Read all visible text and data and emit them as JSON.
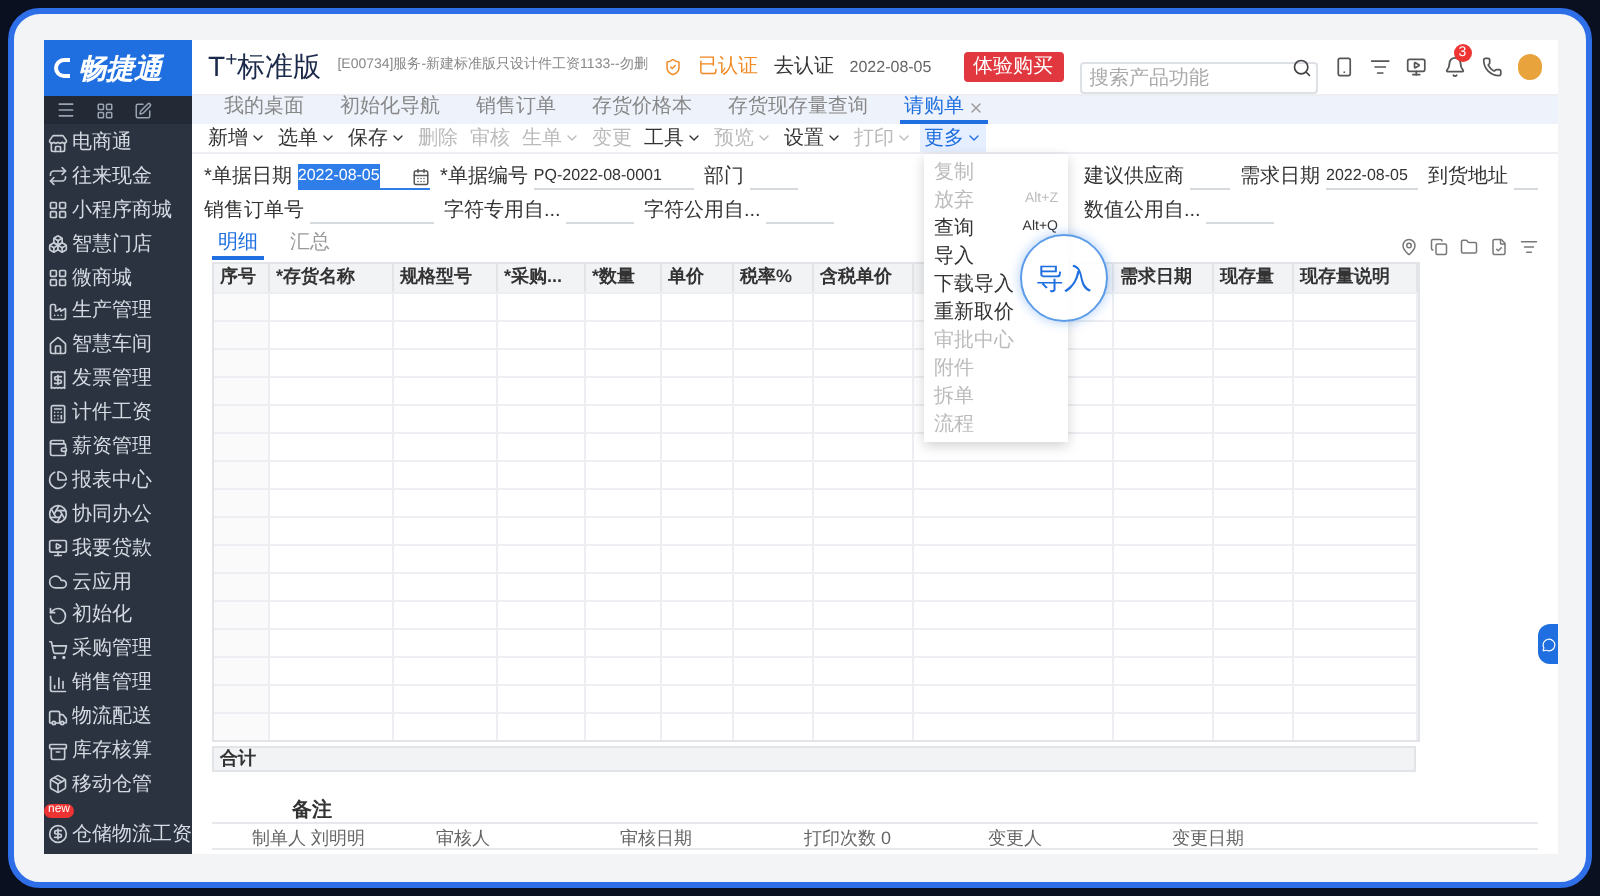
{
  "logo": "畅捷通",
  "product": "T$^{+}$标准版",
  "account": "[E00734]服务-新建标准版只设计件工资1133--勿删",
  "certification": {
    "status": "已认证",
    "action": "去认证"
  },
  "date": "2022-08-05",
  "trial_button": "体验购买",
  "search": {
    "placeholder": "搜索产品功能"
  },
  "notification_badge": "3",
  "sidebar": {
    "items": [
      {
        "label": "电商通"
      },
      {
        "label": "往来现金"
      },
      {
        "label": "小程序商城"
      },
      {
        "label": "智慧门店"
      },
      {
        "label": "微商城"
      },
      {
        "label": "生产管理"
      },
      {
        "label": "智慧车间"
      },
      {
        "label": "发票管理"
      },
      {
        "label": "计件工资"
      },
      {
        "label": "薪资管理"
      },
      {
        "label": "报表中心"
      },
      {
        "label": "协同办公"
      },
      {
        "label": "我要贷款"
      },
      {
        "label": "云应用"
      },
      {
        "label": "初始化"
      },
      {
        "label": "采购管理"
      },
      {
        "label": "销售管理"
      },
      {
        "label": "物流配送"
      },
      {
        "label": "库存核算"
      },
      {
        "label": "移动仓管"
      },
      {
        "label": "仓储物流工资",
        "badge": "new"
      }
    ]
  },
  "tabs": [
    {
      "label": "我的桌面",
      "selected": false,
      "closable": false
    },
    {
      "label": "初始化导航",
      "selected": false,
      "closable": false
    },
    {
      "label": "销售订单",
      "selected": false,
      "closable": false
    },
    {
      "label": "存货价格本",
      "selected": false,
      "closable": false
    },
    {
      "label": "存货现存量查询",
      "selected": false,
      "closable": false
    },
    {
      "label": "请购单",
      "selected": true,
      "closable": true
    }
  ],
  "toolbar": [
    {
      "label": "新增",
      "dropdown": true,
      "disabled": false,
      "open": false
    },
    {
      "label": "选单",
      "dropdown": true,
      "disabled": false,
      "open": false
    },
    {
      "label": "保存",
      "dropdown": true,
      "disabled": false,
      "open": false
    },
    {
      "label": "删除",
      "dropdown": false,
      "disabled": true,
      "open": false
    },
    {
      "label": "审核",
      "dropdown": false,
      "disabled": true,
      "open": false
    },
    {
      "label": "生单",
      "dropdown": true,
      "disabled": true,
      "open": false
    },
    {
      "label": "变更",
      "dropdown": false,
      "disabled": true,
      "open": false
    },
    {
      "label": "工具",
      "dropdown": true,
      "disabled": false,
      "open": false
    },
    {
      "label": "预览",
      "dropdown": true,
      "disabled": true,
      "open": false
    },
    {
      "label": "设置",
      "dropdown": true,
      "disabled": false,
      "open": false
    },
    {
      "label": "打印",
      "dropdown": true,
      "disabled": true,
      "open": false
    },
    {
      "label": "更多",
      "dropdown": true,
      "disabled": false,
      "open": true
    }
  ],
  "more_menu": [
    {
      "label": "复制",
      "disabled": true
    },
    {
      "label": "放弃",
      "shortcut": "Alt+Z",
      "disabled": true
    },
    {
      "label": "查询",
      "shortcut": "Alt+Q",
      "disabled": false
    },
    {
      "label": "导入",
      "disabled": false
    },
    {
      "label": "下载导入",
      "disabled": false
    },
    {
      "label": "重新取价",
      "disabled": false
    },
    {
      "label": "审批中心",
      "disabled": true
    },
    {
      "label": "附件",
      "disabled": true
    },
    {
      "label": "拆单",
      "disabled": true
    },
    {
      "label": "流程",
      "disabled": true
    }
  ],
  "callout": "导入",
  "form": {
    "rows": [
      [
        {
          "label": "*单据日期",
          "value": "2022-08-05",
          "kind": "date",
          "highlighted": true
        },
        {
          "label": "*单据编号",
          "value": "PQ-2022-08-0001",
          "kind": "text",
          "highlighted": false
        },
        {
          "label": "部门",
          "kind": "text",
          "highlighted": false
        },
        {
          "label": "建议供应商",
          "kind": "text",
          "highlighted": false
        },
        {
          "label": "需求日期",
          "value": "2022-08-05",
          "kind": "text",
          "highlighted": false
        },
        {
          "label": "到货地址",
          "kind": "text",
          "highlighted": false
        }
      ],
      [
        {
          "label": "销售订单号",
          "kind": "text",
          "highlighted": false
        },
        {
          "label": "字符专用自...",
          "kind": "text",
          "highlighted": false
        },
        {
          "label": "字符公用自...",
          "kind": "text",
          "highlighted": false
        },
        {
          "label": "数值公用自...",
          "kind": "text",
          "highlighted": false
        }
      ]
    ]
  },
  "subtabs": [
    {
      "label": "明细",
      "selected": true
    },
    {
      "label": "汇总",
      "selected": false
    }
  ],
  "table": {
    "columns": [
      {
        "label": "序号"
      },
      {
        "label": "*存货名称"
      },
      {
        "label": "规格型号"
      },
      {
        "label": "*采购..."
      },
      {
        "label": "*数量"
      },
      {
        "label": "单价"
      },
      {
        "label": "税率%"
      },
      {
        "label": "含税单价"
      },
      {
        "label": "需求日期"
      },
      {
        "label": "现存量"
      },
      {
        "label": "现存量说明"
      }
    ],
    "total_label": "合计"
  },
  "remarks_label": "备注",
  "footer": [
    {
      "label": "制单人",
      "value": "刘明明"
    },
    {
      "label": "审核人"
    },
    {
      "label": "审核日期"
    },
    {
      "label": "打印次数",
      "value": "0"
    },
    {
      "label": "变更人"
    },
    {
      "label": "变更日期"
    }
  ]
}
